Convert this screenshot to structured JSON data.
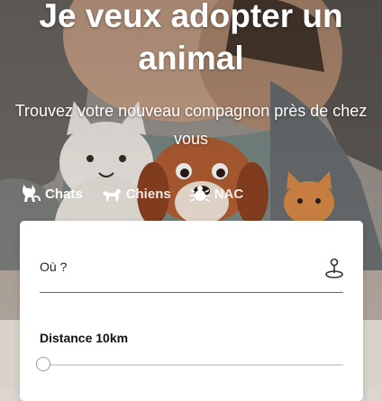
{
  "hero": {
    "title": "Je veux adopter un animal",
    "subtitle": "Trouvez votre nouveau compagnon près de chez vous"
  },
  "tabs": [
    {
      "label": "Chats",
      "icon": "cat-icon",
      "active": true
    },
    {
      "label": "Chiens",
      "icon": "dog-icon",
      "active": false
    },
    {
      "label": "NAC",
      "icon": "nac-icon",
      "active": false
    }
  ],
  "search": {
    "location_label": "Où ?",
    "location_button_icon": "location-pin-icon",
    "distance_label": "Distance 10km",
    "distance_slider_fraction": 0
  },
  "colors": {
    "text_on_hero": "#ffffff",
    "card_background": "#ffffff"
  }
}
